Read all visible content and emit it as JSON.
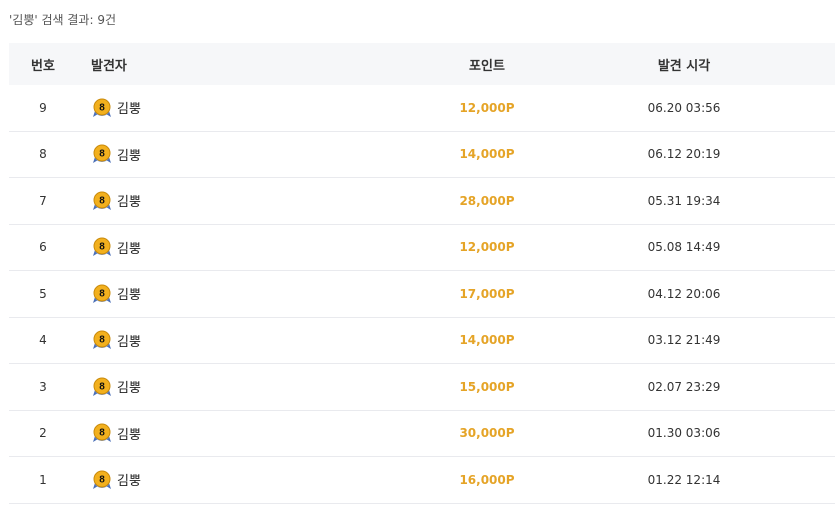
{
  "summary": "'김뿡' 검색 결과: 9건",
  "columns": {
    "no": "번호",
    "finder": "발견자",
    "points": "포인트",
    "time": "발견 시각"
  },
  "badge": {
    "icon": "level-8-medal-icon",
    "level": "8",
    "gold": "#f2b01e",
    "ribbon": "#6a8fd6"
  },
  "rows": [
    {
      "no": "9",
      "finder": "김뿡",
      "points": "12,000P",
      "time": "06.20 03:56"
    },
    {
      "no": "8",
      "finder": "김뿡",
      "points": "14,000P",
      "time": "06.12 20:19"
    },
    {
      "no": "7",
      "finder": "김뿡",
      "points": "28,000P",
      "time": "05.31 19:34"
    },
    {
      "no": "6",
      "finder": "김뿡",
      "points": "12,000P",
      "time": "05.08 14:49"
    },
    {
      "no": "5",
      "finder": "김뿡",
      "points": "17,000P",
      "time": "04.12 20:06"
    },
    {
      "no": "4",
      "finder": "김뿡",
      "points": "14,000P",
      "time": "03.12 21:49"
    },
    {
      "no": "3",
      "finder": "김뿡",
      "points": "15,000P",
      "time": "02.07 23:29"
    },
    {
      "no": "2",
      "finder": "김뿡",
      "points": "30,000P",
      "time": "01.30 03:06"
    },
    {
      "no": "1",
      "finder": "김뿡",
      "points": "16,000P",
      "time": "01.22 12:14"
    }
  ]
}
